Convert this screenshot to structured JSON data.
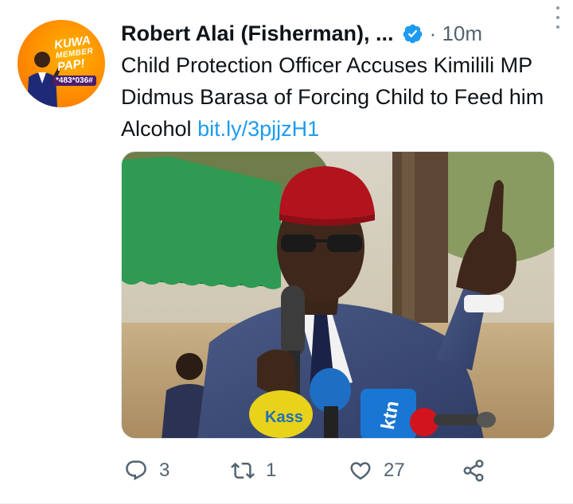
{
  "tweet": {
    "author_name": "Robert Alai (Fisherman), ...",
    "time": "· 10m",
    "text": "Child Protection Officer Accuses Kimilili MP Didmus Barasa of Forcing Child to Feed him Alcohol ",
    "link": "bit.ly/3pjjzH1"
  },
  "avatar": {
    "line1": "KUWA",
    "line2": "MEMBER",
    "line3": "PAP!",
    "code": "*483*036#"
  },
  "media": {
    "cap": "ktn",
    "mic_label": "Kass"
  },
  "actions": {
    "replies": "3",
    "retweets": "1",
    "likes": "27"
  },
  "colors": {
    "link": "#1d9bf0",
    "verified": "#1d9bf0",
    "muted": "#536471"
  },
  "icons": [
    "verified-badge-icon",
    "more-icon",
    "reply-icon",
    "retweet-icon",
    "like-icon",
    "share-icon"
  ]
}
